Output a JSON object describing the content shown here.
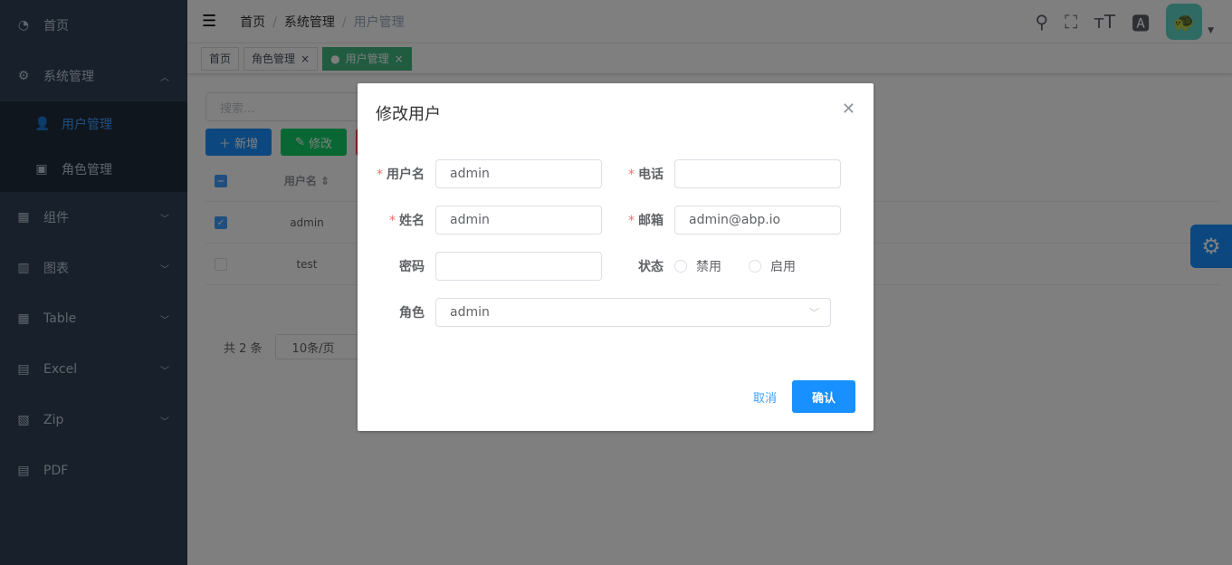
{
  "sidebar": {
    "items": [
      {
        "label": "首页",
        "icon": "dashboard-icon"
      },
      {
        "label": "系统管理",
        "icon": "gear-icon",
        "sub": [
          {
            "label": "用户管理"
          },
          {
            "label": "角色管理"
          }
        ]
      },
      {
        "label": "组件"
      },
      {
        "label": "图表"
      },
      {
        "label": "Table"
      },
      {
        "label": "Excel"
      },
      {
        "label": "Zip"
      },
      {
        "label": "PDF"
      }
    ]
  },
  "breadcrumb": [
    "首页",
    "系统管理",
    "用户管理"
  ],
  "tags": [
    "首页",
    "角色管理",
    "用户管理"
  ],
  "content": {
    "search_placeholder": "搜索...",
    "add": "新增",
    "edit": "修改",
    "col_username": "用户名",
    "rows": [
      "admin",
      "test"
    ],
    "total": "共 2 条",
    "page_size": "10条/页"
  },
  "dialog": {
    "title": "修改用户",
    "username_label": "用户名",
    "username": "admin",
    "phone_label": "电话",
    "phone": "",
    "name_label": "姓名",
    "name": "admin",
    "email_label": "邮箱",
    "email": "admin@abp.io",
    "password_label": "密码",
    "status_label": "状态",
    "status_options": [
      "禁用",
      "启用"
    ],
    "role_label": "角色",
    "role": "admin",
    "cancel": "取消",
    "confirm": "确认"
  }
}
